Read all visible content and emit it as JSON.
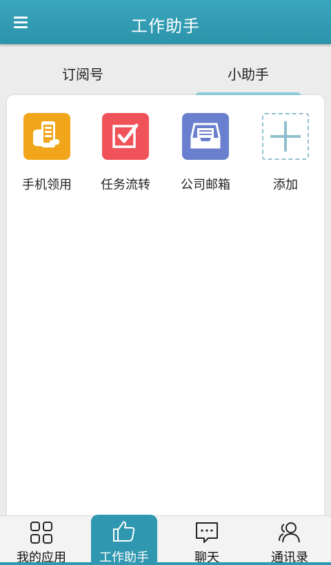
{
  "header": {
    "title": "工作助手",
    "menu_icon": "menu-icon"
  },
  "tabs": [
    {
      "label": "订阅号",
      "active": false
    },
    {
      "label": "小助手",
      "active": true
    }
  ],
  "apps": [
    {
      "label": "手机领用",
      "icon": "phone-hand-icon",
      "color": "#f0a51b"
    },
    {
      "label": "任务流转",
      "icon": "checkbox-icon",
      "color": "#f0525a"
    },
    {
      "label": "公司邮箱",
      "icon": "inbox-icon",
      "color": "#6a7fcd"
    },
    {
      "label": "添加",
      "icon": "add-icon",
      "color": "#8fbfcc"
    }
  ],
  "bottom_nav": [
    {
      "label": "我的应用",
      "icon": "grid-icon",
      "active": false
    },
    {
      "label": "工作助手",
      "icon": "thumbs-up-icon",
      "active": true
    },
    {
      "label": "聊天",
      "icon": "chat-bubble-icon",
      "active": false
    },
    {
      "label": "通讯录",
      "icon": "contacts-icon",
      "active": false
    }
  ],
  "colors": {
    "accent": "#2f97af",
    "tab_indicator": "#8ecfde"
  }
}
